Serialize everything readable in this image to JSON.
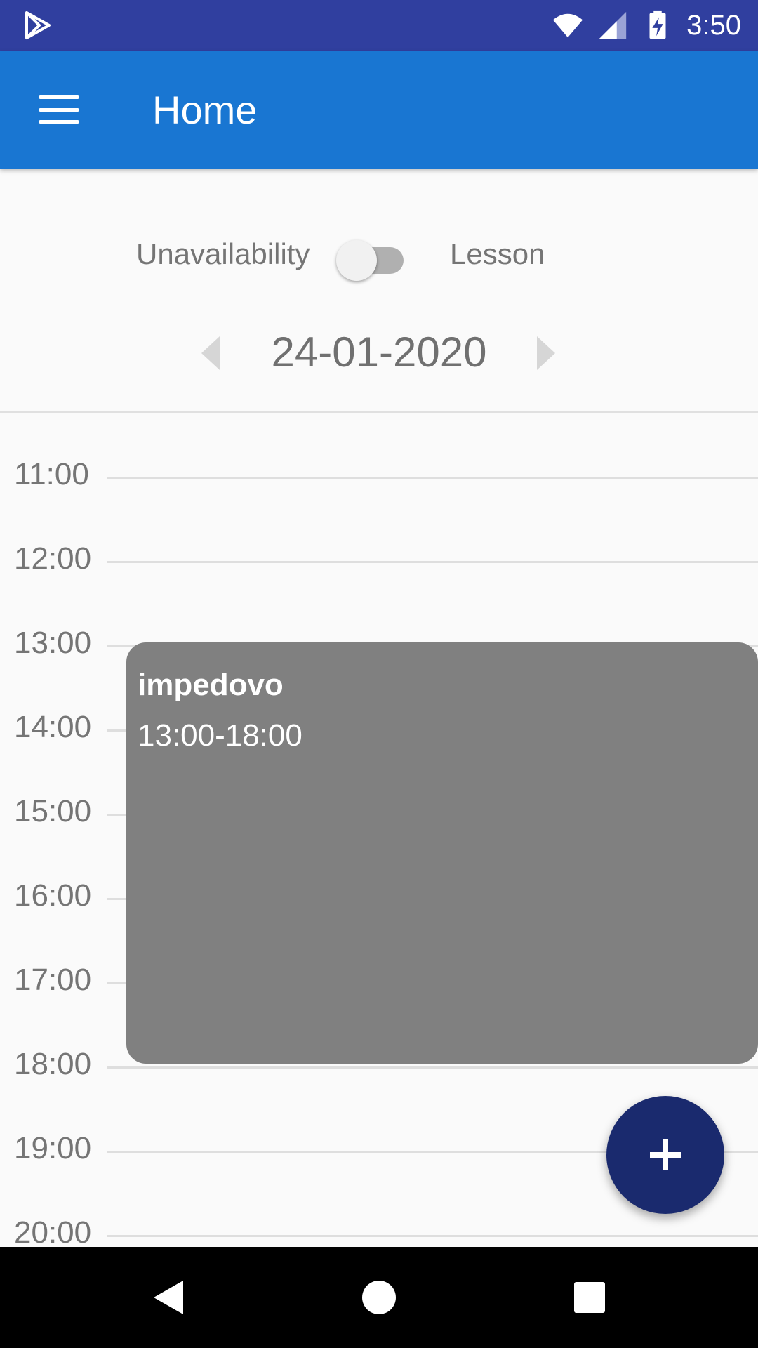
{
  "status_bar": {
    "time": "3:50",
    "icons": [
      "play-store-icon",
      "wifi-icon",
      "cell-signal-icon",
      "battery-charging-icon"
    ]
  },
  "app_bar": {
    "title": "Home",
    "menu_icon": "hamburger-menu-icon",
    "color": "#1976d2"
  },
  "mode_toggle": {
    "left_label": "Unavailability",
    "right_label": "Lesson",
    "checked": false
  },
  "date_nav": {
    "date": "24-01-2020",
    "prev_icon": "arrow-left-icon",
    "next_icon": "arrow-right-icon"
  },
  "timeline": {
    "hours": [
      "11:00",
      "12:00",
      "13:00",
      "14:00",
      "15:00",
      "16:00",
      "17:00",
      "18:00",
      "19:00",
      "20:00"
    ],
    "events": [
      {
        "title": "impedovo",
        "time_range": "13:00-18:00",
        "color": "#808080"
      }
    ]
  },
  "fab": {
    "icon": "plus-icon",
    "color": "#1a2a6e"
  },
  "nav_bar": {
    "icons": [
      "back-icon",
      "home-icon",
      "recent-apps-icon"
    ]
  }
}
